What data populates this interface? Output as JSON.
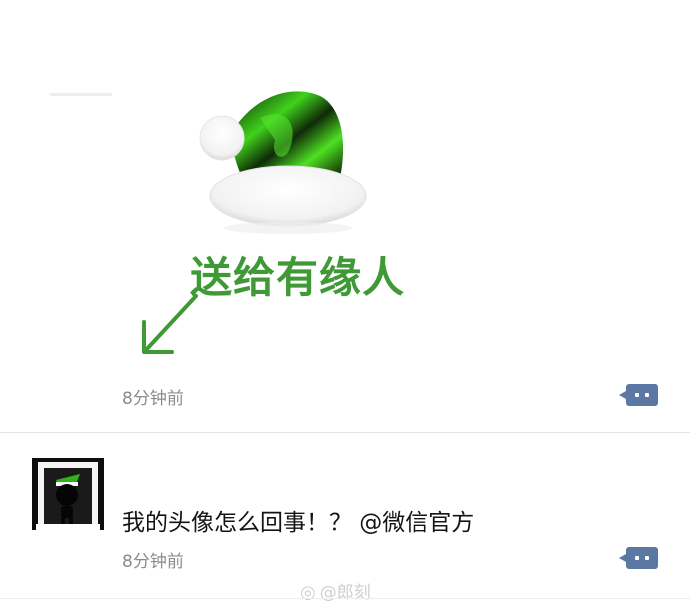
{
  "post1": {
    "caption": "送给有缘人",
    "time": "8分钟前",
    "comment_icon": "comment-icon"
  },
  "post2": {
    "text": "我的头像怎么回事！？ @微信官方",
    "time": "8分钟前",
    "comment_icon": "comment-icon"
  },
  "watermark": {
    "text": "@郎刻",
    "icon": "weibo-icon"
  },
  "colors": {
    "caption_green": "#3f9a36",
    "hat_green": "#3fd21c",
    "comment_button": "#5b78a5",
    "time_gray": "#8b8b8b"
  }
}
